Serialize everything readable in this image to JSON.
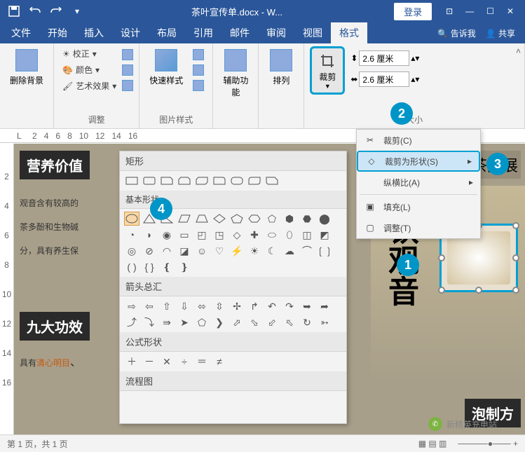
{
  "title": "茶叶宣传单.docx - W...",
  "login": "登录",
  "qat": {
    "save": "💾"
  },
  "win": {
    "min": "—",
    "max": "☐",
    "close": "✕",
    "restore": "⊡"
  },
  "menu": {
    "tabs": [
      "文件",
      "开始",
      "插入",
      "设计",
      "布局",
      "引用",
      "邮件",
      "审阅",
      "视图",
      "格式"
    ],
    "active": 9,
    "tell_me": "告诉我",
    "share": "共享"
  },
  "ribbon": {
    "remove_bg": "删除背景",
    "adjust": {
      "label": "调整",
      "corrections": "校正",
      "color": "颜色",
      "artistic": "艺术效果"
    },
    "styles": {
      "label": "图片样式",
      "quick": "快速样式"
    },
    "access": {
      "label": "辅助功能",
      "alt": "辅助功\n能"
    },
    "arrange": {
      "label": "排列",
      "btn": "排列"
    },
    "size": {
      "label": "大小",
      "crop": "裁剪",
      "h": "2.6 厘米",
      "w": "2.6 厘米"
    }
  },
  "crop_menu": {
    "crop": "裁剪(C)",
    "crop_to_shape": "裁剪为形状(S)",
    "aspect": "纵横比(A)",
    "fill": "填充(L)",
    "fit": "调整(T)"
  },
  "shapes": {
    "rect": "矩形",
    "basic": "基本形状",
    "arrows": "箭头总汇",
    "equation": "公式形状",
    "flowchart": "流程图"
  },
  "ruler_h": [
    "2",
    "4",
    "6",
    "8",
    "10",
    "12",
    "14",
    "16"
  ],
  "ruler_v": [
    "2",
    "4",
    "6",
    "8",
    "10",
    "12",
    "14",
    "16"
  ],
  "doc": {
    "h1": "营养价值",
    "l1": "观音含有较高的",
    "l2": "茶多酚和生物碱",
    "l3": "分，具有养生保",
    "h2": "九大功效",
    "l4": "具有",
    "l4b": "清心明目",
    "r1": "茶品展",
    "r2": "泡制方"
  },
  "status": {
    "page": "第 1 页，共 1 页",
    "zoom": "+"
  },
  "watermark": "新精英充电站",
  "callouts": {
    "1": "1",
    "2": "2",
    "3": "3",
    "4": "4"
  }
}
